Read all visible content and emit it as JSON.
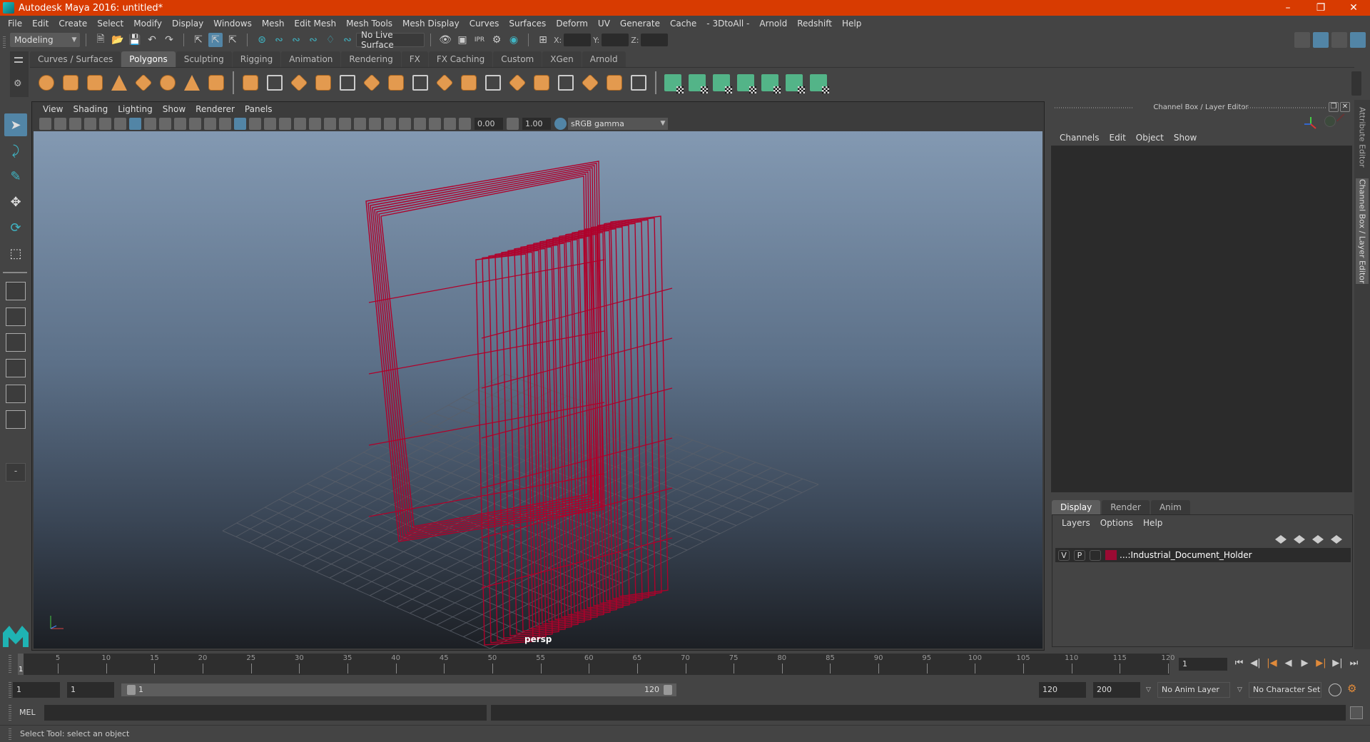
{
  "window": {
    "title": "Autodesk Maya 2016: untitled*",
    "controls": [
      "minimize",
      "restore",
      "close"
    ]
  },
  "menubar": [
    "File",
    "Edit",
    "Create",
    "Select",
    "Modify",
    "Display",
    "Windows",
    "Mesh",
    "Edit Mesh",
    "Mesh Tools",
    "Mesh Display",
    "Curves",
    "Surfaces",
    "Deform",
    "UV",
    "Generate",
    "Cache",
    "- 3DtoAll -",
    "Arnold",
    "Redshift",
    "Help"
  ],
  "toolbar": {
    "mode": "Modeling",
    "live_surface": "No Live Surface",
    "x_label": "X:",
    "y_label": "Y:",
    "z_label": "Z:",
    "x_value": "",
    "y_value": "",
    "z_value": ""
  },
  "shelf": {
    "tabs": [
      "Curves / Surfaces",
      "Polygons",
      "Sculpting",
      "Rigging",
      "Animation",
      "Rendering",
      "FX",
      "FX Caching",
      "Custom",
      "XGen",
      "Arnold"
    ],
    "active_tab": "Polygons",
    "icons_primitives": [
      "poly-sphere-icon",
      "poly-cube-icon",
      "poly-cylinder-icon",
      "poly-cone-icon",
      "poly-diamond-icon",
      "poly-torus-icon",
      "poly-pyramid-icon",
      "poly-pipe-icon"
    ],
    "icons_mesh": [
      "combine-icon",
      "separate-icon",
      "mirror-icon",
      "smooth-icon",
      "extrude-icon",
      "bevel-icon",
      "bridge-icon",
      "multicut-icon",
      "insert-edgeloop-icon",
      "collapse-icon",
      "target-weld-icon",
      "offset-edgeloop-icon",
      "append-icon",
      "merge-icon",
      "fill-hole-icon",
      "triangulate-icon",
      "quadrangulate-icon"
    ],
    "icons_uv": [
      "planar-uv-icon",
      "cylindrical-uv-icon",
      "spherical-uv-icon",
      "automatic-uv-icon",
      "unfold-uv-icon",
      "uv-editor-icon",
      "layout-uv-icon"
    ]
  },
  "viewport": {
    "menu": [
      "View",
      "Shading",
      "Lighting",
      "Show",
      "Renderer",
      "Panels"
    ],
    "exposure": "0.00",
    "gamma": "1.00",
    "color_space": "sRGB gamma",
    "camera": "persp",
    "object_color": "#b0002a"
  },
  "channel_box": {
    "title": "Channel Box / Layer Editor",
    "menu": [
      "Channels",
      "Edit",
      "Object",
      "Show"
    ]
  },
  "layer_editor": {
    "tabs": [
      "Display",
      "Render",
      "Anim"
    ],
    "active_tab": "Display",
    "menu": [
      "Layers",
      "Options",
      "Help"
    ],
    "layers": [
      {
        "visible": "V",
        "playback": "P",
        "color": "#9b0a33",
        "name": "...:Industrial_Document_Holder"
      }
    ]
  },
  "side_tabs": [
    "Attribute Editor",
    "Channel Box / Layer Editor"
  ],
  "timeline": {
    "ticks": [
      5,
      10,
      15,
      20,
      25,
      30,
      35,
      40,
      45,
      50,
      55,
      60,
      65,
      70,
      75,
      80,
      85,
      90,
      95,
      100,
      105,
      110,
      115,
      120
    ],
    "current_frame_marker": "1",
    "current_frame": "1",
    "min_frame": 1,
    "max_frame": 120
  },
  "range": {
    "start": "1",
    "anim_start": "1",
    "slider_start": "1",
    "slider_end": "120",
    "end": "120",
    "anim_end": "200",
    "anim_layer": "No Anim Layer",
    "character_set": "No Character Set"
  },
  "command_line": {
    "label": "MEL",
    "input": "",
    "output": ""
  },
  "help_line": "Select Tool: select an object"
}
